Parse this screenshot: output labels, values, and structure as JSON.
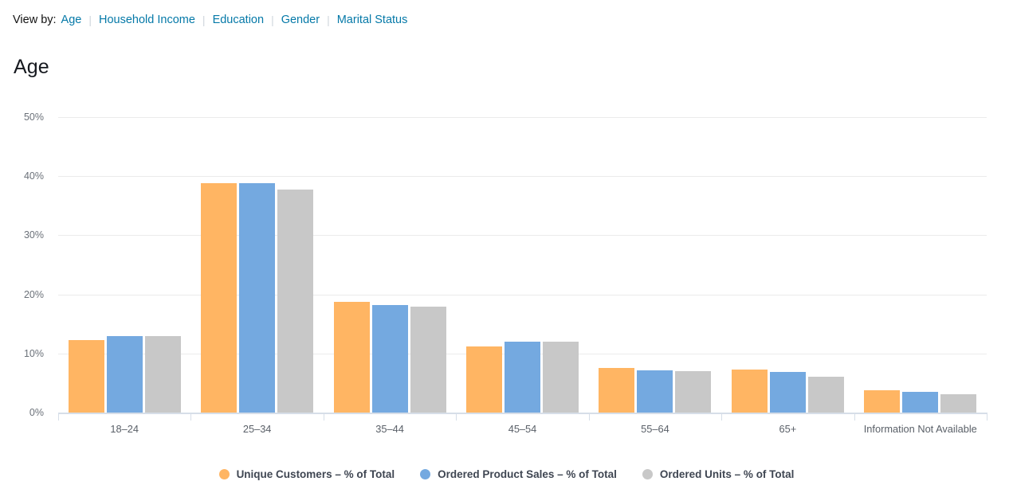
{
  "viewby": {
    "label": "View by:",
    "separator": "|",
    "links": [
      {
        "label": "Age"
      },
      {
        "label": "Household Income"
      },
      {
        "label": "Education"
      },
      {
        "label": "Gender"
      },
      {
        "label": "Marital Status"
      }
    ]
  },
  "chart_title": "Age",
  "colors": {
    "link": "#0579A8",
    "unique_customers": "#FFB563",
    "ordered_product_sales": "#74A9E0",
    "ordered_units": "#C8C8C8",
    "gridline": "#EBEBEB",
    "axis": "#D6DEE8",
    "tick_text": "#6B7179"
  },
  "chart_data": {
    "type": "bar",
    "title": "Age",
    "xlabel": "",
    "ylabel": "",
    "ylim": [
      0,
      50
    ],
    "yticks": [
      0,
      10,
      20,
      30,
      40,
      50
    ],
    "ytick_labels": [
      "0%",
      "10%",
      "20%",
      "30%",
      "40%",
      "50%"
    ],
    "grid": true,
    "legend_position": "bottom",
    "categories": [
      "18–24",
      "25–34",
      "35–44",
      "45–54",
      "55–64",
      "65+",
      "Information Not Available"
    ],
    "series": [
      {
        "name": "Unique Customers – % of Total",
        "color": "#FFB563",
        "values": [
          12.3,
          38.8,
          18.7,
          11.2,
          7.6,
          7.3,
          3.8
        ]
      },
      {
        "name": "Ordered Product Sales – % of Total",
        "color": "#74A9E0",
        "values": [
          13.0,
          38.8,
          18.2,
          12.0,
          7.2,
          6.9,
          3.5
        ]
      },
      {
        "name": "Ordered Units – % of Total",
        "color": "#C8C8C8",
        "values": [
          13.0,
          37.8,
          17.9,
          12.0,
          7.0,
          6.0,
          3.1
        ]
      }
    ]
  }
}
